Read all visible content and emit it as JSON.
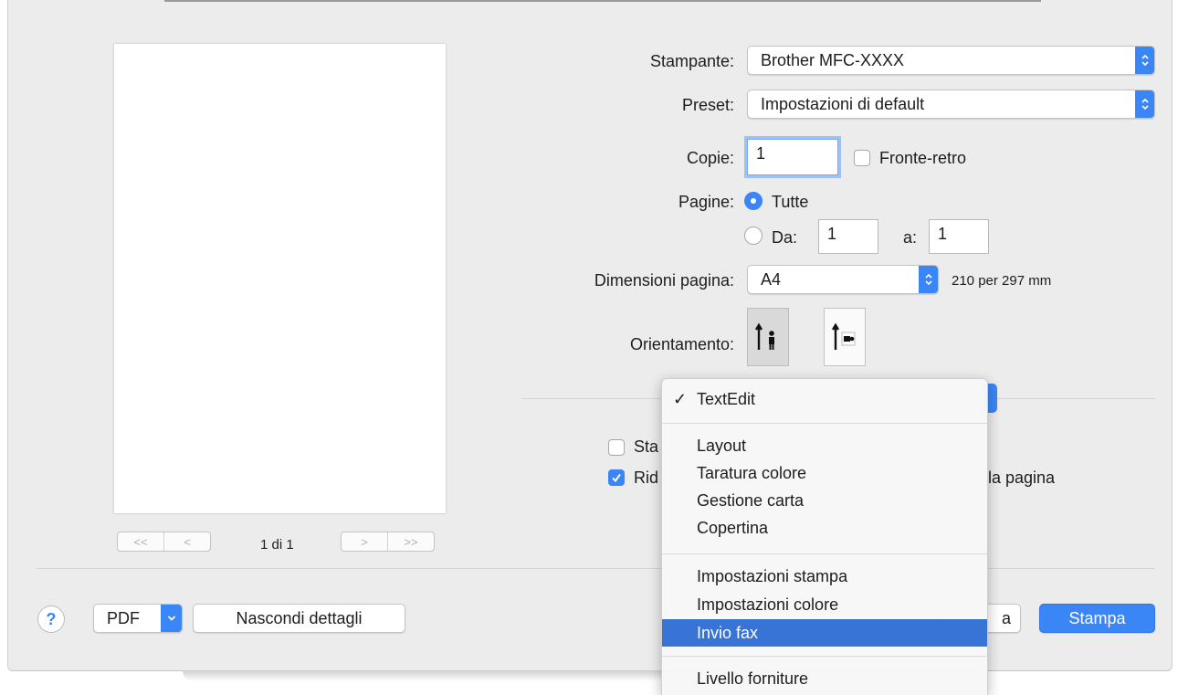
{
  "preview": {
    "page_count": "1 di 1",
    "nav_first": "<<",
    "nav_prev": "<",
    "nav_next": ">",
    "nav_last": ">>"
  },
  "printer": {
    "label": "Stampante:",
    "value": "Brother MFC-XXXX"
  },
  "preset": {
    "label": "Preset:",
    "value": "Impostazioni di default"
  },
  "copies": {
    "label": "Copie:",
    "value": "1",
    "duplex_label": "Fronte-retro",
    "duplex_checked": false
  },
  "pages": {
    "label": "Pagine:",
    "all_label": "Tutte",
    "range_label": "Da:",
    "from_value": "1",
    "to_label": "a:",
    "to_value": "1"
  },
  "paper_size": {
    "label": "Dimensioni pagina:",
    "value": "A4",
    "dimensions": "210 per 297 mm"
  },
  "orientation": {
    "label": "Orientamento:",
    "selected": "portrait"
  },
  "options": {
    "checkbox1_text": "Sta",
    "checkbox1_checked": false,
    "checkbox2_text": "Rid",
    "checkbox2_tail": "la pagina",
    "checkbox2_checked": true
  },
  "footer": {
    "help": "?",
    "pdf": "PDF",
    "hide_details": "Nascondi dettagli",
    "cancel_partial": "a",
    "print": "Stampa"
  },
  "menu": {
    "checked_item": "TextEdit",
    "check_mark": "✓",
    "group1": [
      "Layout",
      "Taratura colore",
      "Gestione carta",
      "Copertina"
    ],
    "group2": [
      "Impostazioni stampa",
      "Impostazioni colore",
      "Invio fax"
    ],
    "group3": [
      "Livello forniture"
    ],
    "highlighted": "Invio fax"
  },
  "colors": {
    "accent": "#3b86f7",
    "highlight": "#3874d6",
    "sheet_bg": "#ececec"
  }
}
